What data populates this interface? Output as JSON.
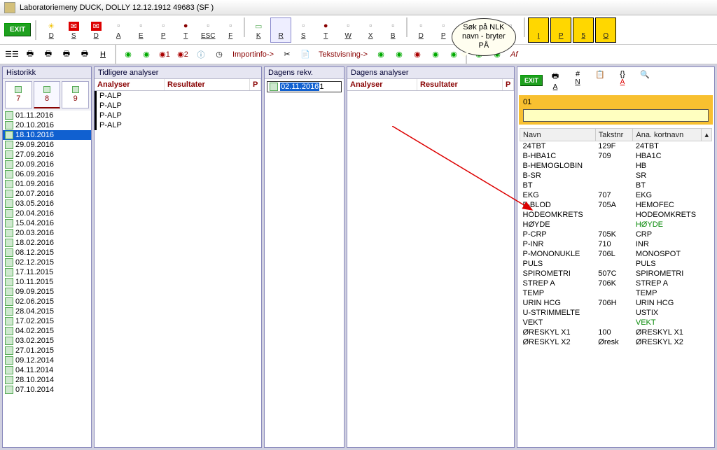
{
  "window": {
    "title": "Laboratoriemeny DUCK, DOLLY 12.12.1912 49683 (SF  )"
  },
  "bubble": {
    "line1": "Søk på NLK",
    "line2": "navn - bryter",
    "line3": "PÅ"
  },
  "toolbar1": {
    "exit": "EXIT",
    "buttons": [
      {
        "l": "D",
        "n": "sun-d"
      },
      {
        "l": "S",
        "n": "env1"
      },
      {
        "l": "D",
        "n": "env2"
      },
      {
        "l": "A",
        "n": "a"
      },
      {
        "l": "E",
        "n": "e"
      },
      {
        "l": "P",
        "n": "p"
      },
      {
        "l": "T",
        "n": "t"
      },
      {
        "l": "ESC",
        "n": "esc"
      },
      {
        "l": "F",
        "n": "f"
      },
      {
        "l": "K",
        "n": "k"
      },
      {
        "l": "R",
        "n": "r"
      },
      {
        "l": "S",
        "n": "s2"
      },
      {
        "l": "T",
        "n": "t2"
      },
      {
        "l": "W",
        "n": "w"
      },
      {
        "l": "X",
        "n": "x"
      },
      {
        "l": "B",
        "n": "b"
      },
      {
        "l": "D",
        "n": "d2"
      },
      {
        "l": "P",
        "n": "p2"
      },
      {
        "l": "",
        "n": "g1"
      },
      {
        "l": "U",
        "n": "u"
      },
      {
        "l": "O",
        "n": "o"
      },
      {
        "l": "I",
        "n": "i"
      },
      {
        "l": "P",
        "n": "p3"
      },
      {
        "l": "5",
        "n": "5"
      },
      {
        "l": "O",
        "n": "o2"
      }
    ]
  },
  "toolbar2": {
    "h": "H",
    "n1": "1",
    "n2": "2",
    "import": "Importinfo->",
    "tekst": "Tekstvisning->",
    "af": "Af"
  },
  "hist": {
    "title": "Historikk",
    "tabs": [
      "7",
      "8",
      "9"
    ],
    "activeTab": 1,
    "dates": [
      "01.11.2016",
      "20.10.2016",
      "18.10.2016",
      "29.09.2016",
      "27.09.2016",
      "20.09.2016",
      "06.09.2016",
      "01.09.2016",
      "20.07.2016",
      "03.05.2016",
      "20.04.2016",
      "15.04.2016",
      "20.03.2016",
      "18.02.2016",
      "08.12.2015",
      "02.12.2015",
      "17.11.2015",
      "10.11.2015",
      "09.09.2015",
      "02.06.2015",
      "28.04.2015",
      "17.02.2015",
      "04.02.2015",
      "03.02.2015",
      "27.01.2015",
      "09.12.2014",
      "04.11.2014",
      "28.10.2014",
      "07.10.2014"
    ],
    "selected": 2
  },
  "prev": {
    "title": "Tidligere analyser",
    "cols": {
      "a": "Analyser",
      "r": "Resultater",
      "p": "P"
    },
    "rows": [
      "P-ALP",
      "P-ALP",
      "P-ALP",
      "P-ALP"
    ]
  },
  "rekv": {
    "title": "Dagens rekv.",
    "date": "02.11.2016",
    "suffix": "1"
  },
  "dag": {
    "title": "Dagens analyser",
    "cols": {
      "a": "Analyser",
      "r": "Resultater",
      "p": "P"
    }
  },
  "right": {
    "exit": "EXIT",
    "tb": [
      {
        "l": "A",
        "n": "ra"
      },
      {
        "l": "N",
        "n": "rn"
      },
      {
        "l": "",
        "n": "ry"
      },
      {
        "l": "A",
        "n": "ra2"
      },
      {
        "l": "",
        "n": "rlast"
      }
    ],
    "code": "01",
    "search": "",
    "cols": {
      "navn": "Navn",
      "tak": "Takstnr",
      "kort": "Ana. kortnavn"
    },
    "rows": [
      {
        "n": "24TBT",
        "t": "129F",
        "k": "24TBT",
        "g": 0
      },
      {
        "n": "B-HBA1C",
        "t": "709",
        "k": "HBA1C",
        "g": 0
      },
      {
        "n": "B-HEMOGLOBIN",
        "t": "",
        "k": "HB",
        "g": 0
      },
      {
        "n": "B-SR",
        "t": "",
        "k": "SR",
        "g": 0
      },
      {
        "n": "BT",
        "t": "",
        "k": "BT",
        "g": 0
      },
      {
        "n": "EKG",
        "t": "707",
        "k": "EKG",
        "g": 0
      },
      {
        "n": "F-BLOD",
        "t": "705A",
        "k": "HEMOFEC",
        "g": 0
      },
      {
        "n": "HODEOMKRETS",
        "t": "",
        "k": "HODEOMKRETS",
        "g": 0
      },
      {
        "n": "HØYDE",
        "t": "",
        "k": "HØYDE",
        "g": 1
      },
      {
        "n": "P-CRP",
        "t": "705K",
        "k": "CRP",
        "g": 0
      },
      {
        "n": "P-INR",
        "t": "710",
        "k": "INR",
        "g": 0
      },
      {
        "n": "P-MONONUKLE",
        "t": "706L",
        "k": "MONOSPOT",
        "g": 0
      },
      {
        "n": "PULS",
        "t": "",
        "k": "PULS",
        "g": 0
      },
      {
        "n": "SPIROMETRI",
        "t": "507C",
        "k": "SPIROMETRI",
        "g": 0
      },
      {
        "n": "STREP A",
        "t": "706K",
        "k": "STREP A",
        "g": 0
      },
      {
        "n": "TEMP",
        "t": "",
        "k": "TEMP",
        "g": 0
      },
      {
        "n": "URIN HCG",
        "t": "706H",
        "k": "URIN HCG",
        "g": 0
      },
      {
        "n": "U-STRIMMELTE",
        "t": "",
        "k": "USTIX",
        "g": 0
      },
      {
        "n": "VEKT",
        "t": "",
        "k": "VEKT",
        "g": 1
      },
      {
        "n": "ØRESKYL X1",
        "t": "100",
        "k": "ØRESKYL X1",
        "g": 0
      },
      {
        "n": "ØRESKYL X2",
        "t": "Øresk",
        "k": "ØRESKYL X2",
        "g": 0
      }
    ]
  }
}
